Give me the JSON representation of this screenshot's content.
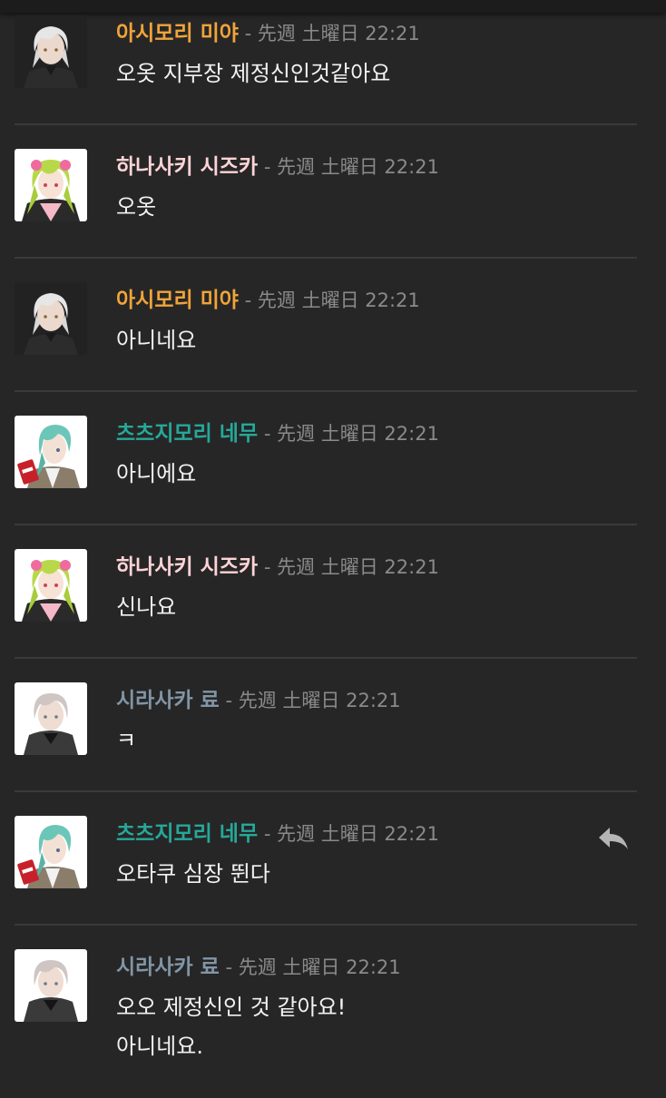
{
  "colors": {
    "background": "#262626",
    "divider": "#3a3a3a",
    "meta": "#8a8a8a",
    "text": "#f2f2f2",
    "author_orange": "#f0a43a",
    "author_pink": "#ffd4d7",
    "author_teal": "#26a899",
    "author_grey": "#8295a6"
  },
  "messages": [
    {
      "avatar": "avatar-white-hair-black-uniform",
      "author": "아시모리 미야",
      "author_color": "#f0a43a",
      "meta": " - 先週 土曜日 22:21",
      "lines": [
        "오옷 지부장 제정신인것같아요"
      ]
    },
    {
      "avatar": "avatar-green-hair-pink",
      "author": "하나사키 시즈카",
      "author_color": "#ffd4d7",
      "meta": " - 先週 土曜日 22:21",
      "lines": [
        "오옷"
      ]
    },
    {
      "avatar": "avatar-white-hair-black-uniform",
      "author": "아시모리 미야",
      "author_color": "#f0a43a",
      "meta": " - 先週 土曜日 22:21",
      "lines": [
        "아니네요"
      ]
    },
    {
      "avatar": "avatar-teal-hair-red-cup",
      "author": "츠츠지모리 네무",
      "author_color": "#26a899",
      "meta": " - 先週 土曜日 22:21",
      "lines": [
        "아니에요"
      ]
    },
    {
      "avatar": "avatar-green-hair-pink",
      "author": "하나사키 시즈카",
      "author_color": "#ffd4d7",
      "meta": " - 先週 土曜日 22:21",
      "lines": [
        "신나요"
      ]
    },
    {
      "avatar": "avatar-silver-hair-black",
      "author": "시라사카 료",
      "author_color": "#8295a6",
      "meta": " - 先週 土曜日 22:21",
      "lines": [
        "ㅋ"
      ]
    },
    {
      "avatar": "avatar-teal-hair-red-cup",
      "author": "츠츠지모리 네무",
      "author_color": "#26a899",
      "meta": " - 先週 土曜日 22:21",
      "lines": [
        "오타쿠 심장 뛴다"
      ],
      "reply_icon": "reply-arrow-icon"
    },
    {
      "avatar": "avatar-silver-hair-black",
      "author": "시라사카 료",
      "author_color": "#8295a6",
      "meta": " - 先週 土曜日 22:21",
      "lines": [
        "오오 제정신인 것 같아요!",
        "아니네요."
      ]
    }
  ]
}
